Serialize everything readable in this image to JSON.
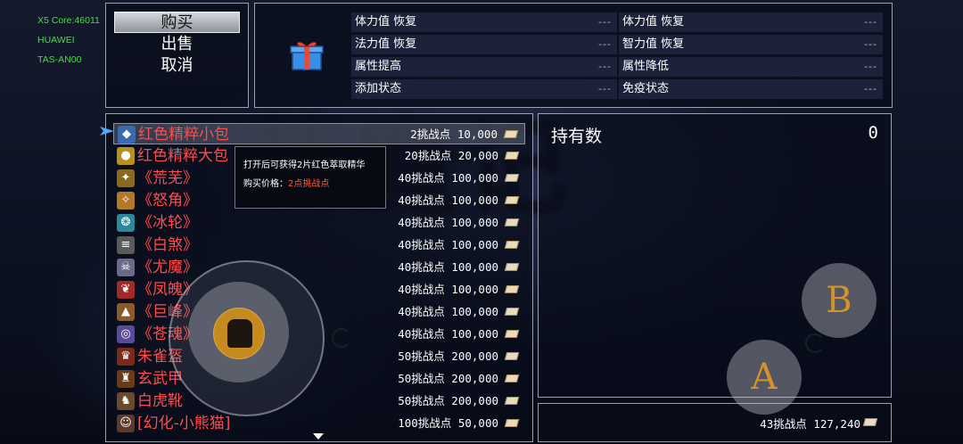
{
  "device": [
    "X5 Core:46011",
    "HUAWEI",
    "TAS-AN00"
  ],
  "commands": [
    {
      "label": "购买",
      "selected": true
    },
    {
      "label": "出售",
      "selected": false
    },
    {
      "label": "取消",
      "selected": false
    }
  ],
  "info": {
    "gift_icon": "gift-box-icon",
    "stats": [
      {
        "label": "体力值 恢复",
        "value": "---"
      },
      {
        "label": "体力值 恢复",
        "value": "---"
      },
      {
        "label": "法力值 恢复",
        "value": "---"
      },
      {
        "label": "智力值 恢复",
        "value": "---"
      },
      {
        "label": "属性提高",
        "value": "---"
      },
      {
        "label": "属性降低",
        "value": "---"
      },
      {
        "label": "添加状态",
        "value": "---"
      },
      {
        "label": "免疫状态",
        "value": "---"
      }
    ]
  },
  "items": [
    {
      "name": "红色精粹小包",
      "cost": "2挑战点 10,000",
      "icon": "blue-gem-icon",
      "color": "#ff4c4c",
      "selected": true
    },
    {
      "name": "红色精粹大包",
      "cost": "20挑战点 20,000",
      "icon": "gold-pouch-icon",
      "color": "#ff4c4c"
    },
    {
      "name": "《荒芜》",
      "cost": "40挑战点 100,000",
      "icon": "wasteland-skill-icon",
      "color": "#ff4c4c"
    },
    {
      "name": "《怒角》",
      "cost": "40挑战点 100,000",
      "icon": "horn-skill-icon",
      "color": "#ff4c4c"
    },
    {
      "name": "《冰轮》",
      "cost": "40挑战点 100,000",
      "icon": "ice-wheel-skill-icon",
      "color": "#ff4c4c"
    },
    {
      "name": "《白煞》",
      "cost": "40挑战点 100,000",
      "icon": "white-fiend-skill-icon",
      "color": "#ff4c4c"
    },
    {
      "name": "《尤魔》",
      "cost": "40挑战点 100,000",
      "icon": "demon-mask-skill-icon",
      "color": "#ff4c4c"
    },
    {
      "name": "《凤魄》",
      "cost": "40挑战点 100,000",
      "icon": "phoenix-skill-icon",
      "color": "#ff4c4c"
    },
    {
      "name": "《巨峰》",
      "cost": "40挑战点 100,000",
      "icon": "giant-peak-skill-icon",
      "color": "#ff4c4c"
    },
    {
      "name": "《苍魂》",
      "cost": "40挑战点 100,000",
      "icon": "azure-soul-skill-icon",
      "color": "#ff4c4c"
    },
    {
      "name": "朱雀盔",
      "cost": "50挑战点 200,000",
      "icon": "vermilion-helmet-icon",
      "color": "#ff4c4c"
    },
    {
      "name": "玄武甲",
      "cost": "50挑战点 200,000",
      "icon": "tortoise-armor-icon",
      "color": "#ff4c4c"
    },
    {
      "name": "白虎靴",
      "cost": "50挑战点 200,000",
      "icon": "tiger-boots-icon",
      "color": "#ff4c4c"
    },
    {
      "name": "[幻化-小熊猫]",
      "cost": "100挑战点 50,000",
      "icon": "red-panda-icon",
      "color": "#ff4c4c"
    }
  ],
  "tooltip": {
    "desc": "打开后可获得2片红色萃取精华",
    "price_label": "购买价格：",
    "price_value": "2点挑战点"
  },
  "holding": {
    "label": "持有数",
    "value": "0"
  },
  "currency": {
    "text": "43挑战点 127,240"
  },
  "controls": {
    "b_label": "B",
    "a_label": "A",
    "knob_icon": "armor-icon"
  },
  "colors": {
    "item_red": "#ff4c4c",
    "button_gold": "#d4922a",
    "device_green": "#40e040"
  }
}
